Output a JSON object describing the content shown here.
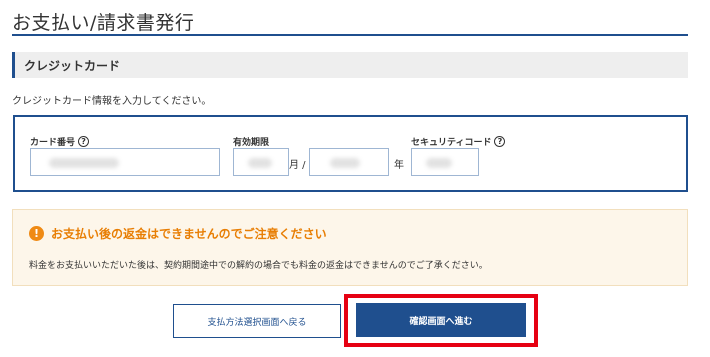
{
  "page": {
    "title": "お支払い/請求書発行"
  },
  "section": {
    "title": "クレジットカード",
    "instruction": "クレジットカード情報を入力してください。"
  },
  "card_form": {
    "card_number_label": "カード番号",
    "expiry_label": "有効期限",
    "month_unit": "月 /",
    "year_unit": "年",
    "security_code_label": "セキュリティコード",
    "help_glyph": "?"
  },
  "notice": {
    "icon_glyph": "!",
    "title": "お支払い後の返金はできませんのでご注意ください",
    "body": "料金をお支払いいただいた後は、契約期間途中での解約の場合でも料金の返金はできませんのでご了承ください。"
  },
  "actions": {
    "back_label": "支払方法選択画面へ戻る",
    "confirm_label": "確認画面へ進む"
  },
  "colors": {
    "brand": "#1f4f8e",
    "warning": "#ef8a14",
    "highlight": "#e60012"
  }
}
